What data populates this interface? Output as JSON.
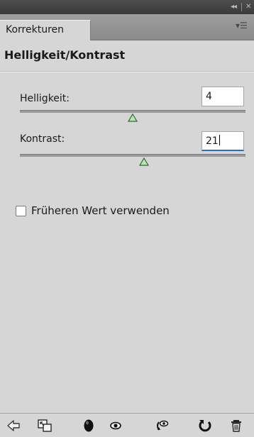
{
  "panel": {
    "tab_label": "Korrekturen",
    "heading": "Helligkeit/Kontrast"
  },
  "controls": [
    {
      "label": "Helligkeit:",
      "value": "4",
      "slider_fraction": 0.5
    },
    {
      "label": "Kontrast:",
      "value": "21",
      "slider_fraction": 0.55
    }
  ],
  "legacy": {
    "label": "Früheren Wert verwenden",
    "checked": false
  },
  "footer_icons": [
    "back-arrow-icon",
    "clip-to-layer-icon",
    "layer-mask-icon",
    "eye-icon",
    "view-previous-state-icon",
    "reset-icon",
    "trash-icon"
  ],
  "colors": {
    "accent": "#2c6ec6",
    "panel_bg": "#d6d6d6",
    "titlebar": "#3a3a3a"
  }
}
